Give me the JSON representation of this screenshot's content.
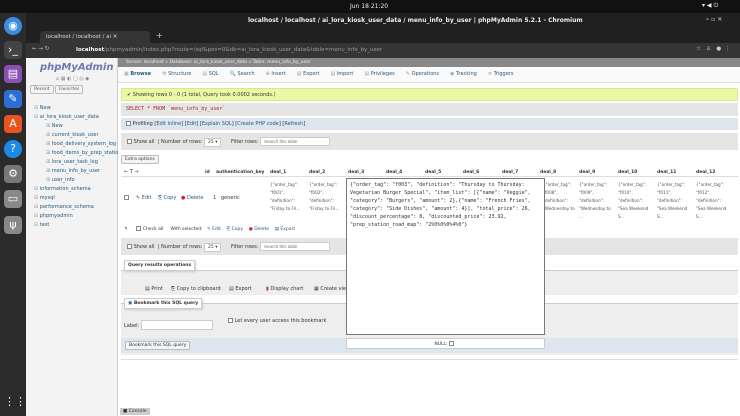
{
  "system": {
    "clock": "Jun 18  21:20"
  },
  "window": {
    "title": "localhost / localhost / ai_lora_kiosk_user_data / menu_info_by_user | phpMyAdmin 5.2.1 - Chromium"
  },
  "browser": {
    "tab_title": "localhost / localhost / ai",
    "url_host": "localhost",
    "url_path": "/phpmyadmin/index.php?route=/sql&pos=0&db=ai_lora_kiosk_user_data&table=menu_info_by_user"
  },
  "sidebar": {
    "logo": "phpMyAdmin",
    "recent": "Recent",
    "favorites": "Favorites",
    "items": [
      {
        "label": "New",
        "level": 0
      },
      {
        "label": "ai_lora_kiosk_user_data",
        "level": 0
      },
      {
        "label": "New",
        "level": 1
      },
      {
        "label": "current_kiosk_user",
        "level": 1
      },
      {
        "label": "food_delivery_system_log",
        "level": 1
      },
      {
        "label": "food_items_by_prep_station",
        "level": 1
      },
      {
        "label": "lora_user_task_log",
        "level": 1
      },
      {
        "label": "menu_info_by_user",
        "level": 1
      },
      {
        "label": "user_info",
        "level": 1
      },
      {
        "label": "information_schema",
        "level": 0
      },
      {
        "label": "mysql",
        "level": 0
      },
      {
        "label": "performance_schema",
        "level": 0
      },
      {
        "label": "phpmyadmin",
        "level": 0
      },
      {
        "label": "test",
        "level": 0
      }
    ]
  },
  "breadcrumb": {
    "server": "Server: localhost",
    "database": "Database: ai_lora_kiosk_user_data",
    "table": "Table: menu_info_by_user"
  },
  "tabs": [
    "Browse",
    "Structure",
    "SQL",
    "Search",
    "Insert",
    "Export",
    "Import",
    "Privileges",
    "Operations",
    "Tracking",
    "Triggers"
  ],
  "message": "Showing rows 0 - 0 (1 total, Query took 0.0002 seconds.)",
  "sql": "SELECT * FROM `menu_info_by_user`",
  "profiling": {
    "label": "Profiling",
    "links": [
      "Edit inline",
      "Edit",
      "Explain SQL",
      "Create PHP code",
      "Refresh"
    ]
  },
  "nav": {
    "show_all": "Show all",
    "rows_label": "Number of rows:",
    "rows_value": "25",
    "filter_label": "Filter rows:",
    "filter_placeholder": "Search this table"
  },
  "extra_options": "Extra options",
  "columns": [
    "id",
    "authentication_key",
    "deal_1",
    "deal_2",
    "deal_3",
    "deal_4",
    "deal_5",
    "deal_6",
    "deal_7",
    "deal_8",
    "deal_9",
    "deal_10",
    "deal_11",
    "deal_12"
  ],
  "row": {
    "edit": "Edit",
    "copy": "Copy",
    "delete": "Delete",
    "id": "1",
    "auth": "generic",
    "deal_1": "{\"order_tag\": \"f001\", \"definition\": \"Friday to Fri...",
    "deal_2": "{\"order_tag\": \"f002\", \"definition\": \"Friday to Fri...",
    "deal_8": "{\"order_tag\": \"f008\", \"definition\": \"Wednesday to",
    "deal_9": "{\"order_tag\": \"f009\", \"definition\": \"Wednesday to ...",
    "deal_10": "{\"order_tag\": \"f010\", \"definition\": \"Sea Weekend S...",
    "deal_11": "{\"order_tag\": \"f011\", \"definition\": \"Sea Weekend S...",
    "deal_12": "{\"order_tag\": \"f012\", \"definition\": \"Sea Weekend S..."
  },
  "editor_value": "{\"order_tag\": \"f003\", \"definition\": \"Thursday to Thursday: Vegetarian Burger Special\", \"item_list\": [{\"name\": \"Veggie\", \"category\": \"Burgers\", \"amount\": 2},{\"name\": \"French Fries\", \"category\": \"Side Dishes\", \"amount\": 4}], \"total_price\": 26, \"discount_percentage\": 8, \"discounted_price\": 23.92, \"prep_station_road_map\": \"2%0%0%0%4%0\"}",
  "null_label": "NULL:",
  "bulk": {
    "check_all": "Check all",
    "with_selected": "With selected:",
    "edit": "Edit",
    "copy": "Copy",
    "delete": "Delete",
    "export": "Export"
  },
  "query_ops": {
    "title": "Query results operations",
    "print": "Print",
    "copy": "Copy to clipboard",
    "export": "Export",
    "chart": "Display chart",
    "view": "Create view"
  },
  "bookmark": {
    "title": "Bookmark this SQL query",
    "label": "Label:",
    "public": "Let every user access this bookmark",
    "button": "Bookmark this SQL query"
  },
  "console": "Console"
}
